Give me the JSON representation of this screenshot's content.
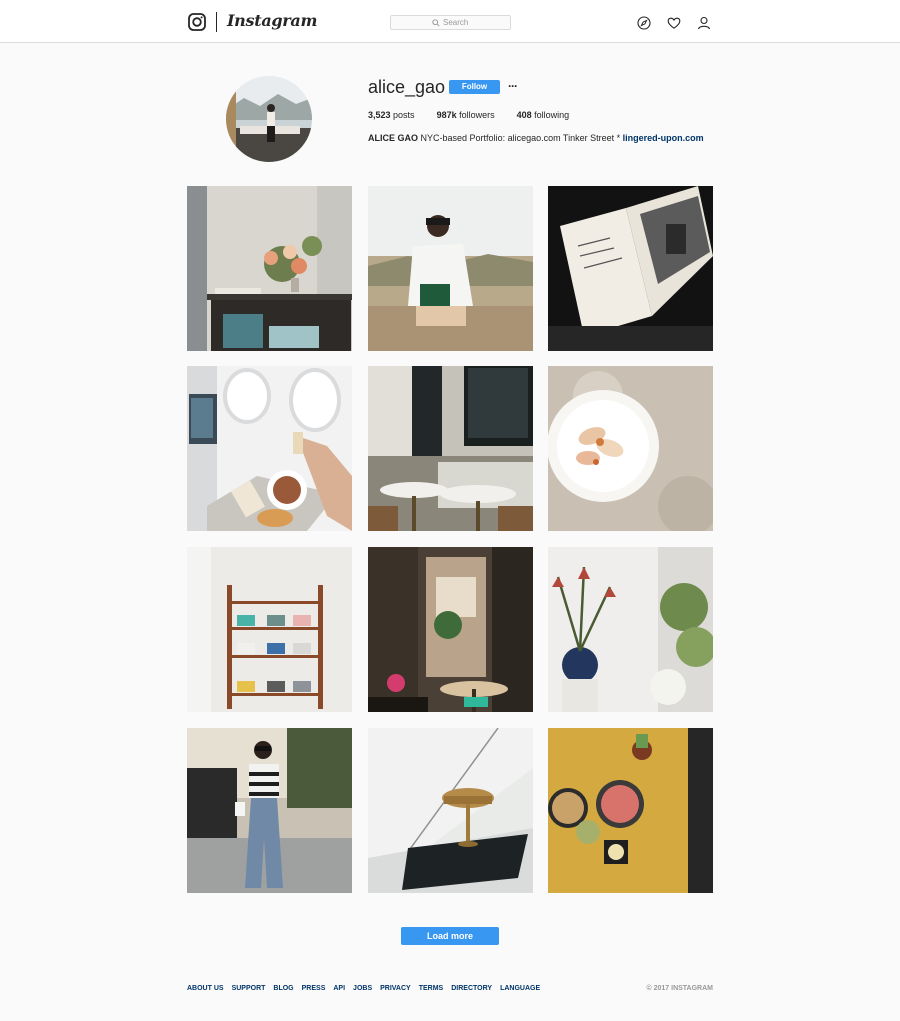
{
  "header": {
    "brand": "Instagram",
    "search_placeholder": "Search"
  },
  "profile": {
    "username": "alice_gao",
    "follow_label": "Follow",
    "more_label": "···",
    "stats": {
      "posts_value": "3,523",
      "posts_label": "posts",
      "followers_value": "987k",
      "followers_label": "followers",
      "following_value": "408",
      "following_label": "following"
    },
    "bio_name": "ALICE GAO",
    "bio_text": "NYC-based Portfolio: alicegao.com Tinker Street *",
    "bio_link": "lingered-upon.com"
  },
  "posts": [
    {
      "subject": "flowers-on-shelf"
    },
    {
      "subject": "woman-in-desert"
    },
    {
      "subject": "open-book"
    },
    {
      "subject": "airplane-meal"
    },
    {
      "subject": "cafe-tables"
    },
    {
      "subject": "plated-dish"
    },
    {
      "subject": "wall-shelf"
    },
    {
      "subject": "cafe-doorway"
    },
    {
      "subject": "flower-vase"
    },
    {
      "subject": "street-portrait"
    },
    {
      "subject": "brass-lamp"
    },
    {
      "subject": "food-table"
    }
  ],
  "load_more_label": "Load more",
  "footer": {
    "links": [
      "ABOUT US",
      "SUPPORT",
      "BLOG",
      "PRESS",
      "API",
      "JOBS",
      "PRIVACY",
      "TERMS",
      "DIRECTORY",
      "LANGUAGE"
    ],
    "copyright": "© 2017 INSTAGRAM"
  },
  "colors": {
    "accent": "#3897f0",
    "link": "#003569",
    "background": "#fafafa",
    "border": "#dbdbdb"
  },
  "icons": [
    "instagram-camera-icon",
    "search-icon",
    "compass-icon",
    "heart-icon",
    "user-icon"
  ]
}
